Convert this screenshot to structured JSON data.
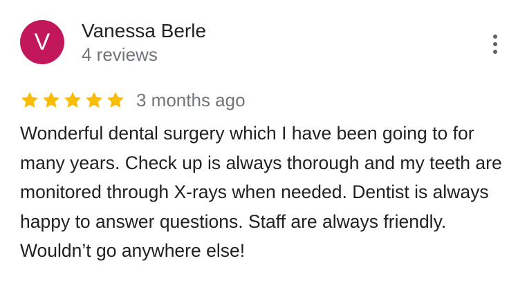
{
  "review": {
    "avatar_initial": "V",
    "avatar_color": "#c2185b",
    "reviewer_name": "Vanessa Berle",
    "review_count": "4 reviews",
    "rating": 5,
    "rating_max": 5,
    "star_color": "#fbbc04",
    "date": "3 months ago",
    "text": "Wonderful dental surgery which I have been going to for many years. Check up is always thorough and my teeth are monitored through X-rays when needed. Dentist is always happy to answer questions. Staff are always friendly. Wouldn’t go anywhere else!",
    "more_icon": "more-vert-icon"
  }
}
